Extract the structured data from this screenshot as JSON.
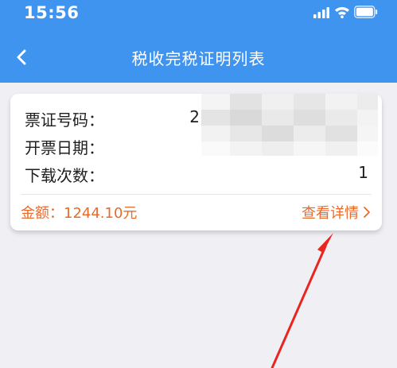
{
  "status_bar": {
    "time": "15:56"
  },
  "nav": {
    "title": "税收完税证明列表",
    "back_icon": "chevron-left-icon"
  },
  "colors": {
    "header_blue": "#3f94f0",
    "page_background": "#efeff4",
    "accent_orange": "#e86a2c",
    "annotation_red": "#e8261f"
  },
  "card": {
    "rows": [
      {
        "label": "票证号码：",
        "value": "2"
      },
      {
        "label": "开票日期：",
        "value": "202"
      },
      {
        "label": "下载次数：",
        "value": "1"
      }
    ],
    "amount_label": "金额：1244.10元",
    "detail_link_label": "查看详情",
    "detail_icon": "chevron-right-icon"
  }
}
